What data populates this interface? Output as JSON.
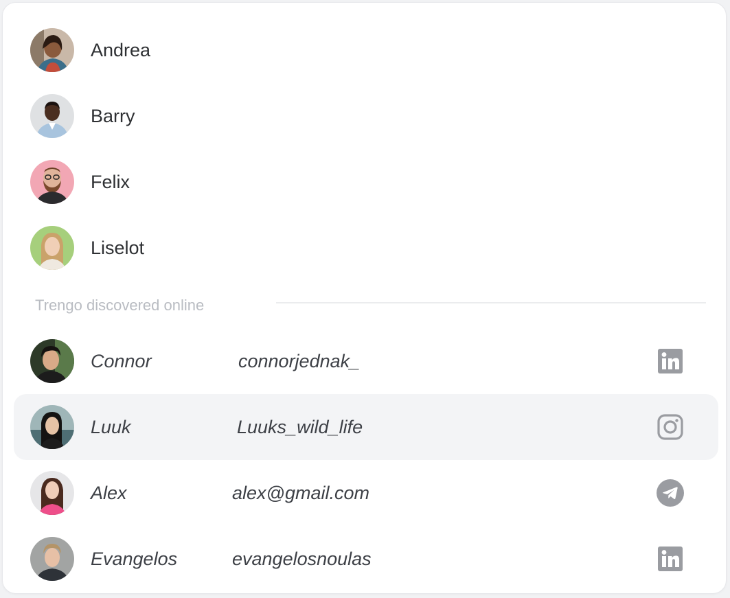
{
  "contacts": [
    {
      "name": "Andrea"
    },
    {
      "name": "Barry"
    },
    {
      "name": "Felix"
    },
    {
      "name": "Liselot"
    }
  ],
  "section_label": "Trengo discovered online",
  "discovered": [
    {
      "name": "Connor",
      "handle": "connorjednak_",
      "network": "linkedin-icon"
    },
    {
      "name": "Luuk",
      "handle": "Luuks_wild_life",
      "network": "instagram-icon"
    },
    {
      "name": "Alex",
      "handle": "alex@gmail.com",
      "network": "telegram-icon"
    },
    {
      "name": "Evangelos",
      "handle": "evangelosnoulas",
      "network": "linkedin-icon"
    }
  ],
  "colors": {
    "highlight_row": "#f3f4f6",
    "icon_gray": "#9a9ca1",
    "label_gray": "#b9bcc2"
  }
}
